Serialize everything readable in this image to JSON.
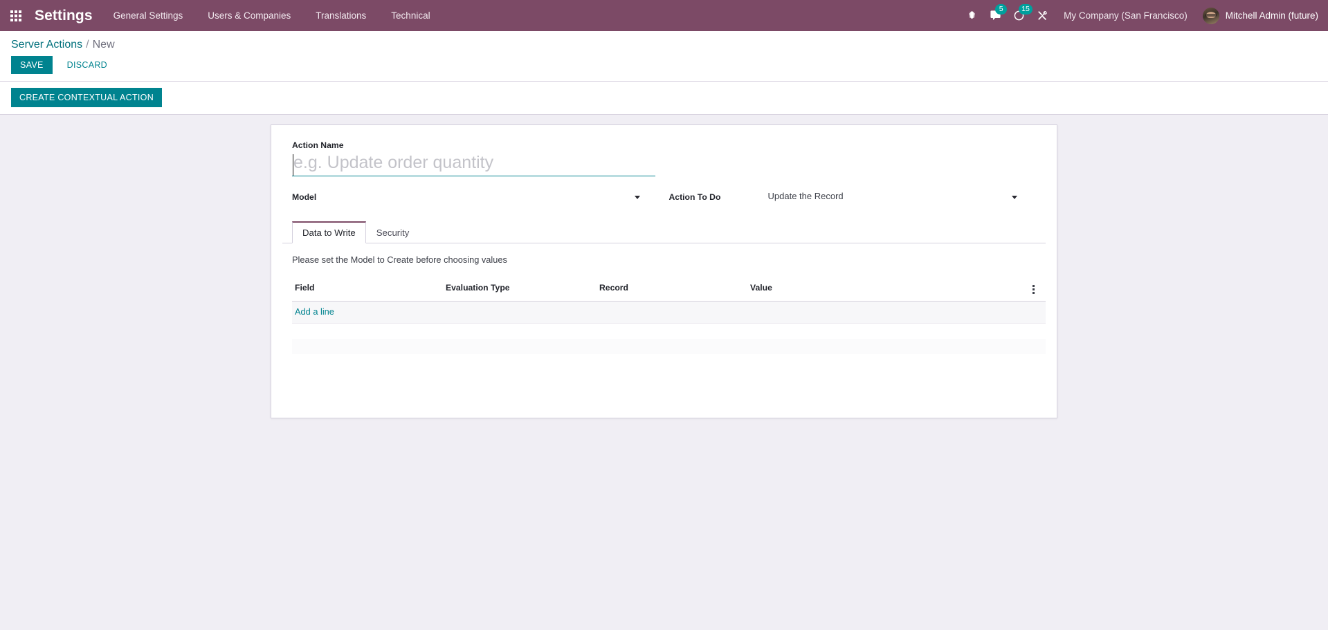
{
  "navbar": {
    "apps_icon": "apps-grid-icon",
    "brand": "Settings",
    "menu": [
      {
        "label": "General Settings"
      },
      {
        "label": "Users & Companies"
      },
      {
        "label": "Translations"
      },
      {
        "label": "Technical"
      }
    ],
    "sys_icons": [
      {
        "name": "bug-icon",
        "badge": ""
      },
      {
        "name": "messages-icon",
        "badge": "5"
      },
      {
        "name": "activities-clock-icon",
        "badge": "15"
      },
      {
        "name": "developer-tools-icon",
        "badge": ""
      }
    ],
    "company": "My Company (San Francisco)",
    "user": "Mitchell Admin (future)",
    "avatar_icon": "user-avatar"
  },
  "control_panel": {
    "breadcrumb_root": "Server Actions",
    "breadcrumb_separator": "/",
    "breadcrumb_current": "New",
    "save_label": "SAVE",
    "discard_label": "DISCARD"
  },
  "action_bar": {
    "create_contextual_action_label": "CREATE CONTEXTUAL ACTION"
  },
  "form": {
    "action_name_label": "Action Name",
    "action_name_value": "",
    "action_name_placeholder": "e.g. Update order quantity",
    "model_label": "Model",
    "model_value": "",
    "model_placeholder": "",
    "action_to_do_label": "Action To Do",
    "action_to_do_value": "Update the Record",
    "action_to_do_placeholder": ""
  },
  "notebook": {
    "tabs": [
      {
        "label": "Data to Write",
        "active": true
      },
      {
        "label": "Security",
        "active": false
      }
    ],
    "data_to_write": {
      "hint": "Please set the Model to Create before choosing values",
      "columns": [
        "Field",
        "Evaluation Type",
        "Record",
        "Value"
      ],
      "rows": [],
      "add_line_label": "Add a line",
      "optional_columns_icon": "vertical-dots-icon"
    }
  },
  "colors": {
    "navbar_bg": "#7c4a66",
    "accent_teal": "#00838f",
    "badge_bg": "#00a09d",
    "active_tab_border": "#7c4a66",
    "page_bg": "#f0eef4"
  }
}
